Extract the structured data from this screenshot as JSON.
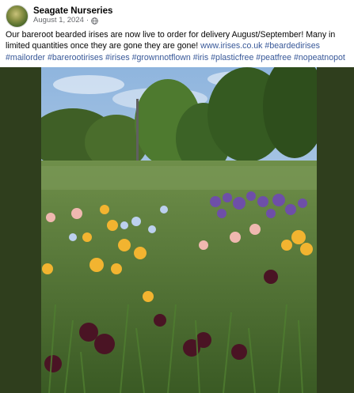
{
  "post": {
    "author": "Seagate Nurseries",
    "date": "August 1, 2024",
    "separator": "·",
    "privacy_icon": "globe-icon",
    "caption": {
      "text": "Our bareroot bearded irises are now live to order for delivery August/September! Many in limited quantities once they are gone they are gone! ",
      "link": "www.irises.co.uk",
      "hashtags": [
        "#beardedirises",
        "#mailorder",
        "#barerootirises",
        "#irises",
        "#grownnotflown",
        "#iris",
        "#plasticfree",
        "#peatfree",
        "#nopeatnopot"
      ]
    }
  },
  "colors": {
    "link": "#385898",
    "frame_background": "#2f3e1d",
    "secondary_text": "#65676b"
  }
}
